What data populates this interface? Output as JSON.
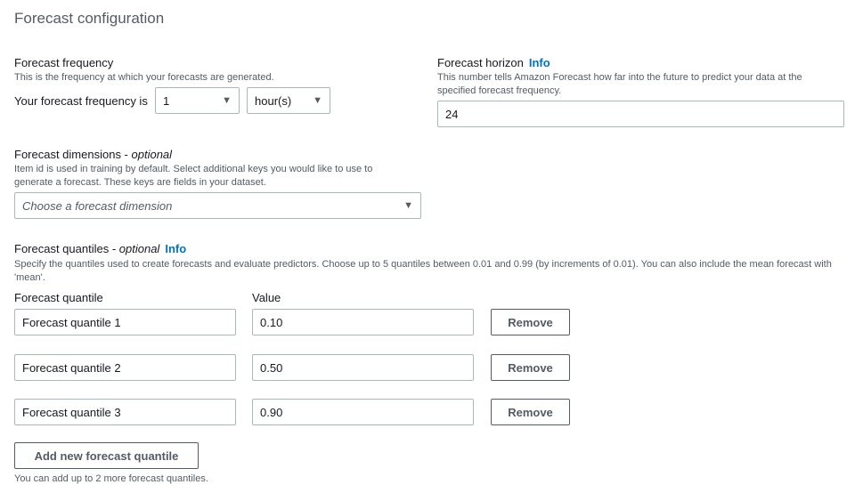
{
  "title": "Forecast configuration",
  "frequency": {
    "label": "Forecast frequency",
    "description": "This is the frequency at which your forecasts are generated.",
    "prefix": "Your forecast frequency is",
    "value": "1",
    "unit": "hour(s)"
  },
  "horizon": {
    "label": "Forecast horizon",
    "info": "Info",
    "description": "This number tells Amazon Forecast how far into the future to predict your data at the specified forecast frequency.",
    "value": "24"
  },
  "dimensions": {
    "label": "Forecast dimensions - ",
    "optional": "optional",
    "description": "Item id is used in training by default. Select additional keys you would like to use to generate a forecast. These keys are fields in your dataset.",
    "placeholder": "Choose a forecast dimension"
  },
  "quantiles": {
    "label": "Forecast quantiles - ",
    "optional": "optional",
    "info": "Info",
    "description": "Specify the quantiles used to create forecasts and evaluate predictors. Choose up to 5 quantiles between 0.01 and 0.99 (by increments of 0.01). You can also include the mean forecast with 'mean'.",
    "col_name": "Forecast quantile",
    "col_value": "Value",
    "rows": [
      {
        "name": "Forecast quantile 1",
        "value": "0.10"
      },
      {
        "name": "Forecast quantile 2",
        "value": "0.50"
      },
      {
        "name": "Forecast quantile 3",
        "value": "0.90"
      }
    ],
    "remove_label": "Remove",
    "add_label": "Add new forecast quantile",
    "note": "You can add up to 2 more forecast quantiles."
  }
}
